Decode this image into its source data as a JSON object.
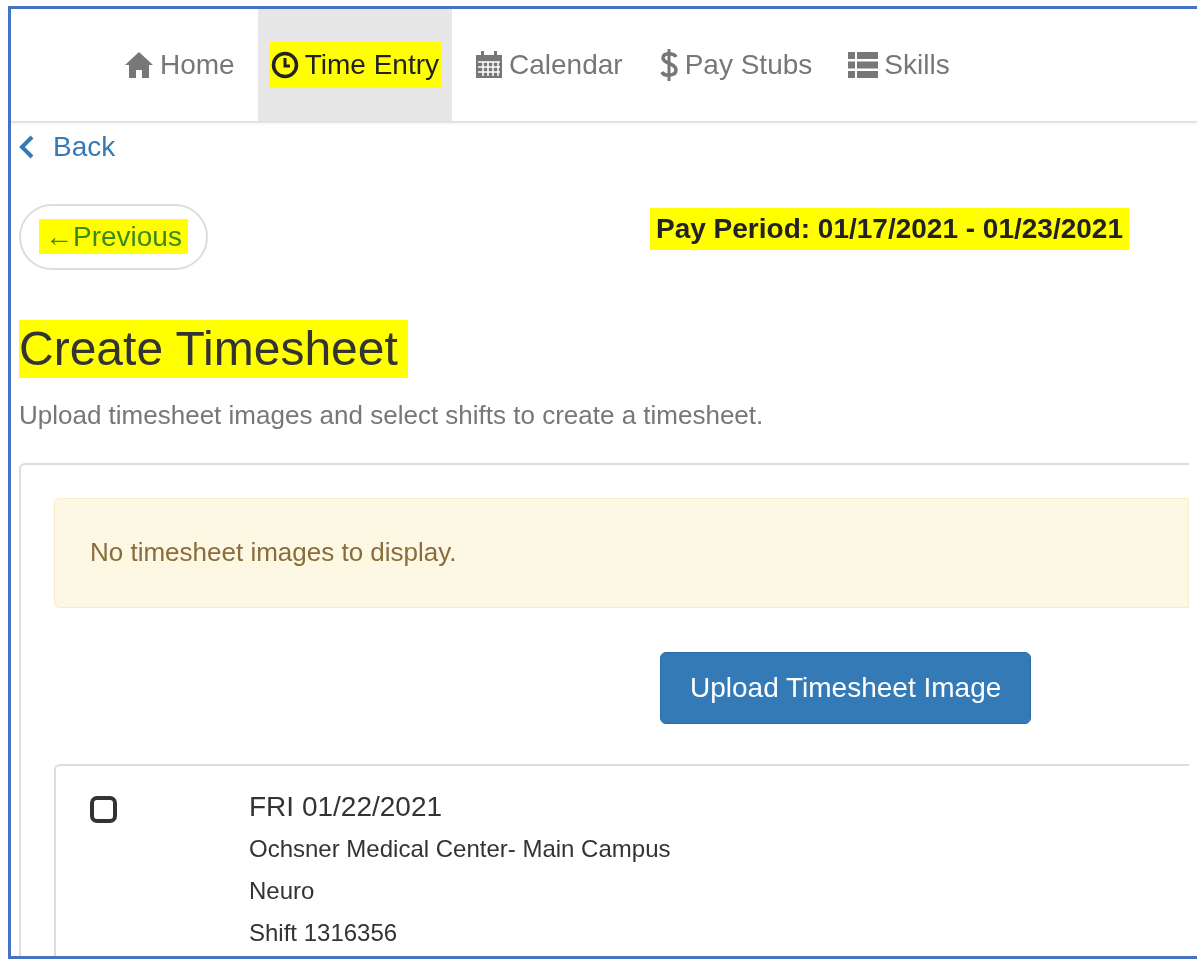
{
  "nav": {
    "tabs": [
      {
        "label": "Home",
        "selected": false,
        "highlighted": false
      },
      {
        "label": "Time Entry",
        "selected": true,
        "highlighted": true
      },
      {
        "label": "Calendar",
        "selected": false,
        "highlighted": false
      },
      {
        "label": "Pay Stubs",
        "selected": false,
        "highlighted": false
      },
      {
        "label": "Skills",
        "selected": false,
        "highlighted": false
      }
    ]
  },
  "back_link": "Back",
  "previous_button": {
    "label": "←Previous",
    "highlighted": true
  },
  "pay_period": {
    "text": "Pay Period: 01/17/2021 - 01/23/2021",
    "highlighted": true
  },
  "title": {
    "text": "Create Timesheet",
    "highlighted": true
  },
  "subtitle": "Upload timesheet images and select shifts to create a timesheet.",
  "alert": "No timesheet images to display.",
  "upload_button": "Upload Timesheet Image",
  "shifts": [
    {
      "checked": false,
      "date": "FRI 01/22/2021",
      "location": "Ochsner Medical Center- Main Campus",
      "unit": "Neuro",
      "shift": "Shift 1316356"
    }
  ]
}
